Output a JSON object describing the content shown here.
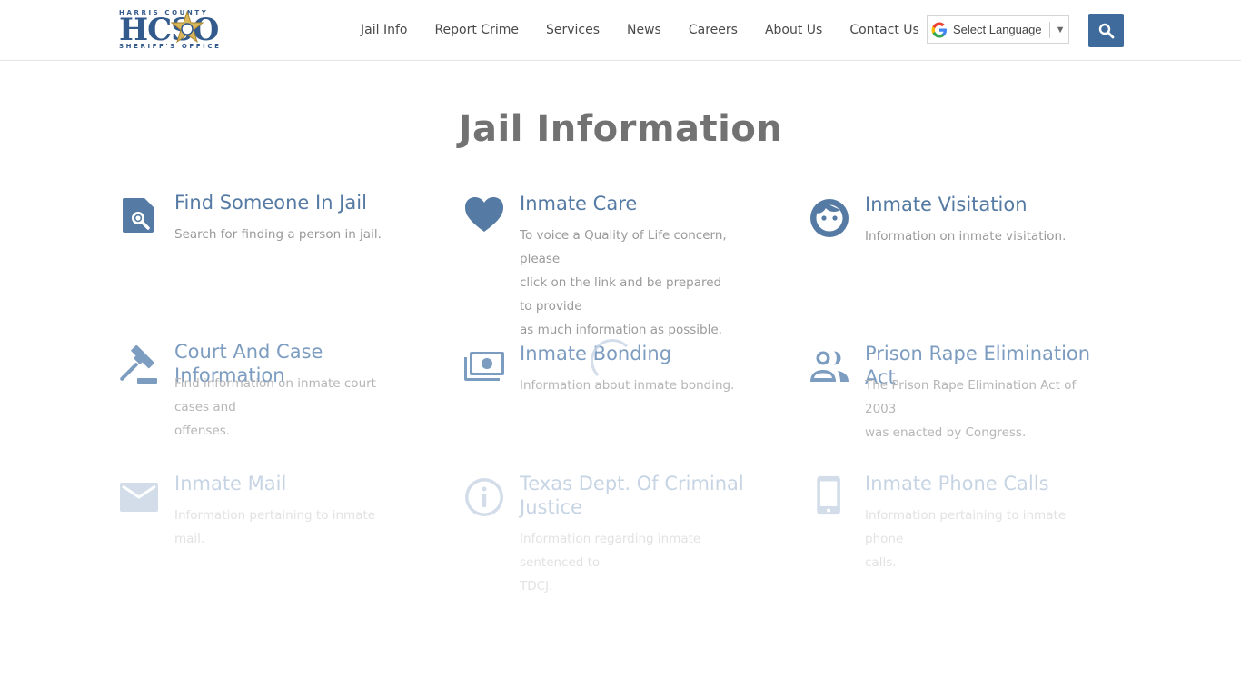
{
  "header": {
    "logo": {
      "top_text": "HARRIS COUNTY",
      "letters": "HCSO",
      "bottom_text": "SHERIFF'S OFFICE"
    },
    "nav": [
      "Jail Info",
      "Report Crime",
      "Services",
      "News",
      "Careers",
      "About Us",
      "Contact Us"
    ],
    "language_select": "Select Language",
    "search_icon": "search-icon"
  },
  "page_title": "Jail Information",
  "cards": [
    {
      "title": "Find Someone In Jail",
      "desc": [
        "Search for finding a person in jail."
      ],
      "icon": "search-document-icon"
    },
    {
      "title": "Inmate Care",
      "desc": [
        "To voice a Quality of Life concern, please",
        "click on the link and be prepared to provide",
        "as much information as possible."
      ],
      "icon": "heart-icon"
    },
    {
      "title": "Inmate Visitation",
      "desc": [
        "Information on inmate visitation."
      ],
      "icon": "face-icon"
    },
    {
      "title": "Court And Case Information",
      "desc": [
        "Find information on inmate court cases and",
        "offenses."
      ],
      "icon": "gavel-icon"
    },
    {
      "title": "Inmate Bonding",
      "desc": [
        "Information about inmate bonding."
      ],
      "icon": "money-icon"
    },
    {
      "title": "Prison Rape Elimination Act",
      "desc": [
        "The Prison Rape Elimination Act of 2003",
        "was enacted by Congress."
      ],
      "icon": "people-icon"
    },
    {
      "title": "Inmate Mail",
      "desc": [
        "Information pertaining to inmate mail."
      ],
      "icon": "mail-icon"
    },
    {
      "title_lines": [
        "Texas Dept. Of Criminal",
        "Justice"
      ],
      "desc": [
        "Information regarding inmate sentenced to",
        "TDCJ."
      ],
      "icon": "info-icon"
    },
    {
      "title": "Inmate Phone Calls",
      "desc": [
        "Information pertaining to inmate phone",
        "calls."
      ],
      "icon": "phone-icon"
    }
  ]
}
